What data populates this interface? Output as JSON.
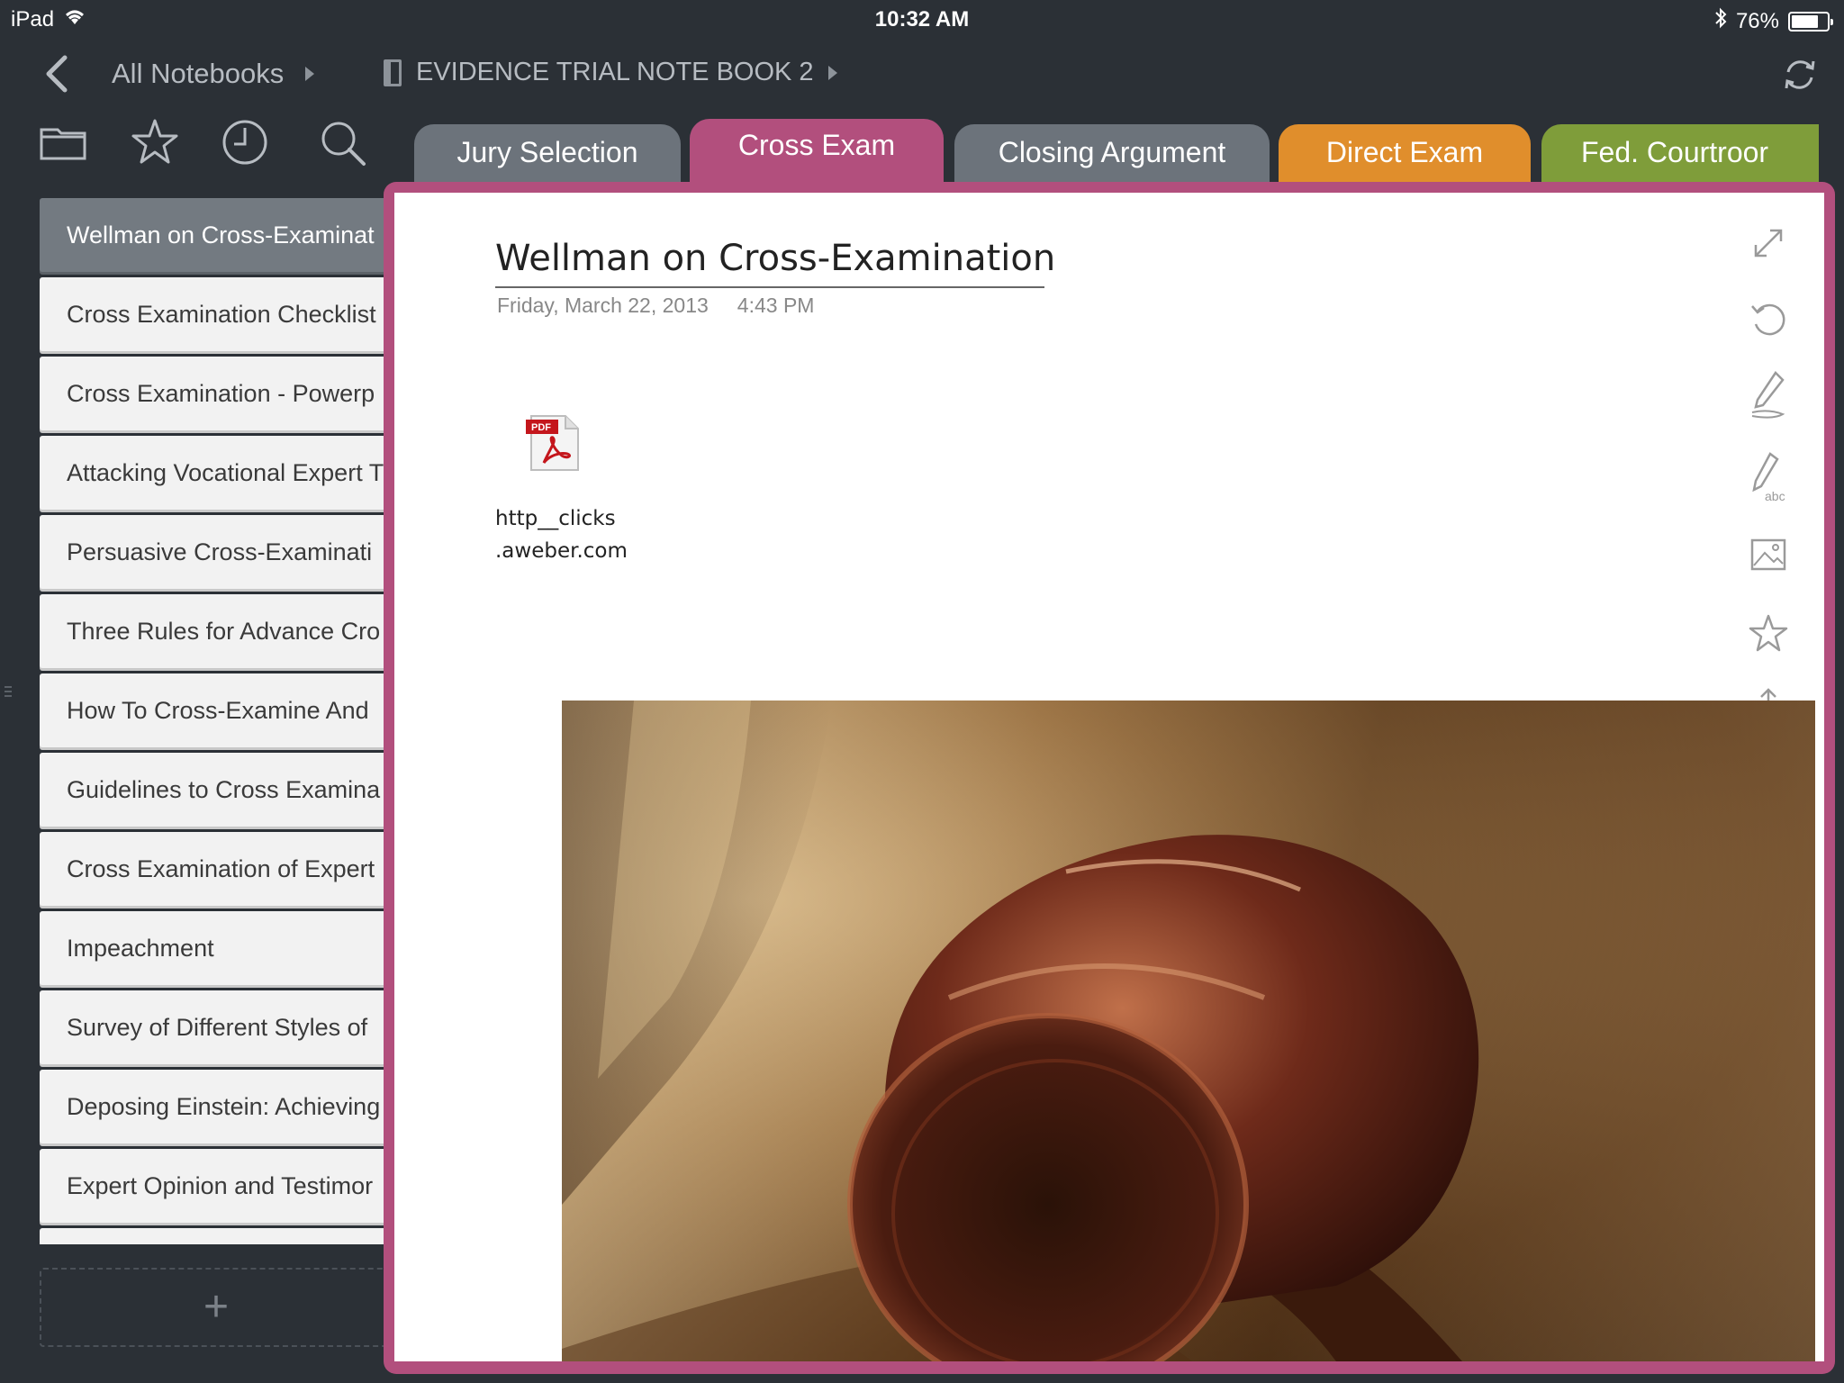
{
  "status_bar": {
    "device": "iPad",
    "time": "10:32 AM",
    "battery_percent_label": "76%",
    "battery_level": 0.76
  },
  "nav": {
    "all_notebooks": "All Notebooks",
    "notebook_title": "EVIDENCE TRIAL NOTE BOOK 2"
  },
  "toolbar": {
    "icons": [
      "folder-icon",
      "star-icon",
      "clock-icon",
      "search-icon"
    ]
  },
  "notes": [
    "Wellman on Cross-Examinat",
    "Cross Examination Checklist",
    "Cross Examination - Powerp",
    "Attacking Vocational Expert T",
    "Persuasive Cross-Examinati",
    "Three Rules for Advance Cro",
    "How To Cross-Examine And",
    "Guidelines to Cross Examina",
    "Cross Examination of Expert",
    "Impeachment",
    "Survey of Different Styles of",
    "Deposing Einstein: Achieving",
    "Expert Opinion and Testimor"
  ],
  "tabs": {
    "jury": "Jury Selection",
    "cross": "Cross Exam",
    "closing": "Closing Argument",
    "direct": "Direct Exam",
    "fed": "Fed. Courtroor"
  },
  "colors": {
    "active_section": "#b24f7d",
    "direct_exam": "#e08e2c",
    "fed_courtroom": "#7f9d3a",
    "inactive_tab": "#6c737b"
  },
  "note": {
    "title": "Wellman on Cross-Examination",
    "date": "Friday, March 22, 2013",
    "time": "4:43 PM",
    "attachment_line1": "http__clicks",
    "attachment_line2": ".aweber.com"
  }
}
